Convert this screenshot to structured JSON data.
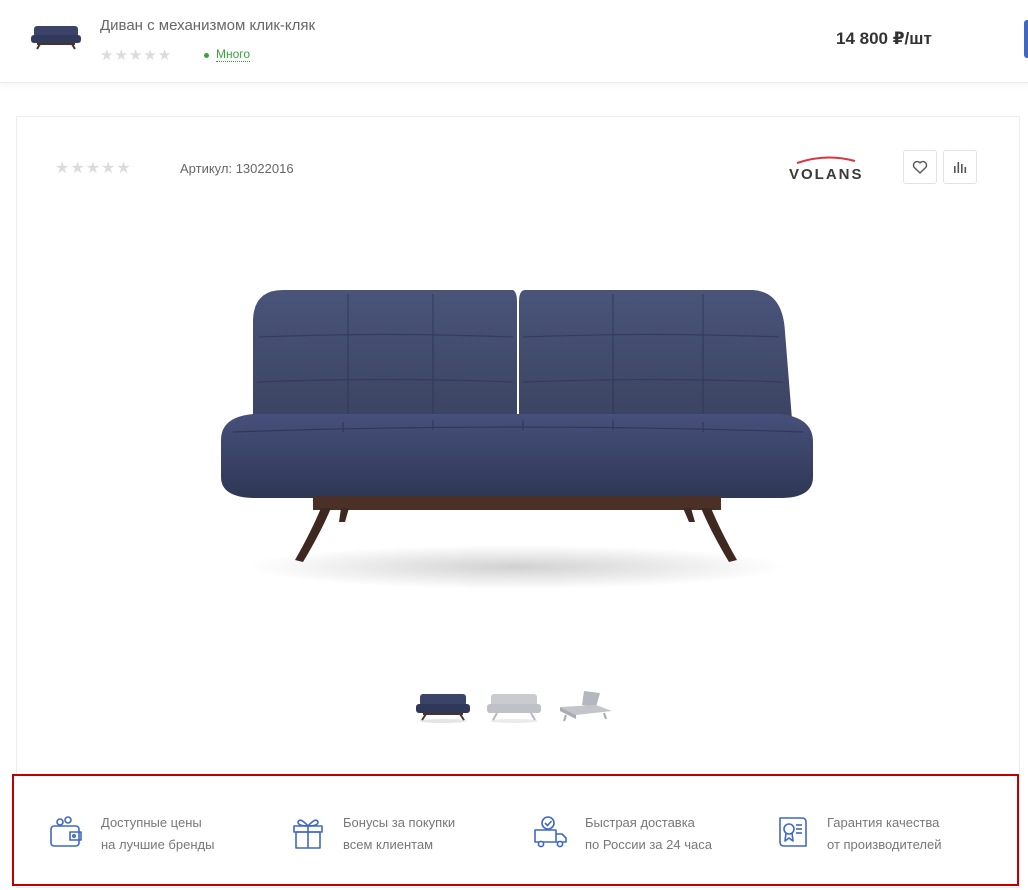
{
  "topbar": {
    "product_title": "Диван с механизмом клик-кляк",
    "rating_stars": "★★★★★",
    "stock_label": "Много",
    "price": "14 800 ₽/шт"
  },
  "card": {
    "rating_stars": "★★★★★",
    "article_label": "Артикул:",
    "article_value": "13022016",
    "brand_name": "VOLANS",
    "actions": [
      {
        "icon": "heart-icon"
      },
      {
        "icon": "compare-bars-icon"
      }
    ],
    "thumbnails": [
      {
        "variant": "navy"
      },
      {
        "variant": "light-grey"
      },
      {
        "variant": "grey-unfolded"
      }
    ]
  },
  "benefits": [
    {
      "icon": "wallet-icon",
      "line1": "Доступные цены",
      "line2": "на лучшие бренды"
    },
    {
      "icon": "gift-icon",
      "line1": "Бонусы за покупки",
      "line2": "всем клиентам"
    },
    {
      "icon": "delivery-truck-icon",
      "line1": "Быстрая доставка",
      "line2": "по России за 24 часа"
    },
    {
      "icon": "certificate-icon",
      "line1": "Гарантия качества",
      "line2": "от производителей"
    }
  ],
  "colors": {
    "accent_blue": "#3f68c6",
    "stock_green": "#3aa33e",
    "sofa_navy": "#3b4468",
    "highlight_border": "#c00000"
  }
}
